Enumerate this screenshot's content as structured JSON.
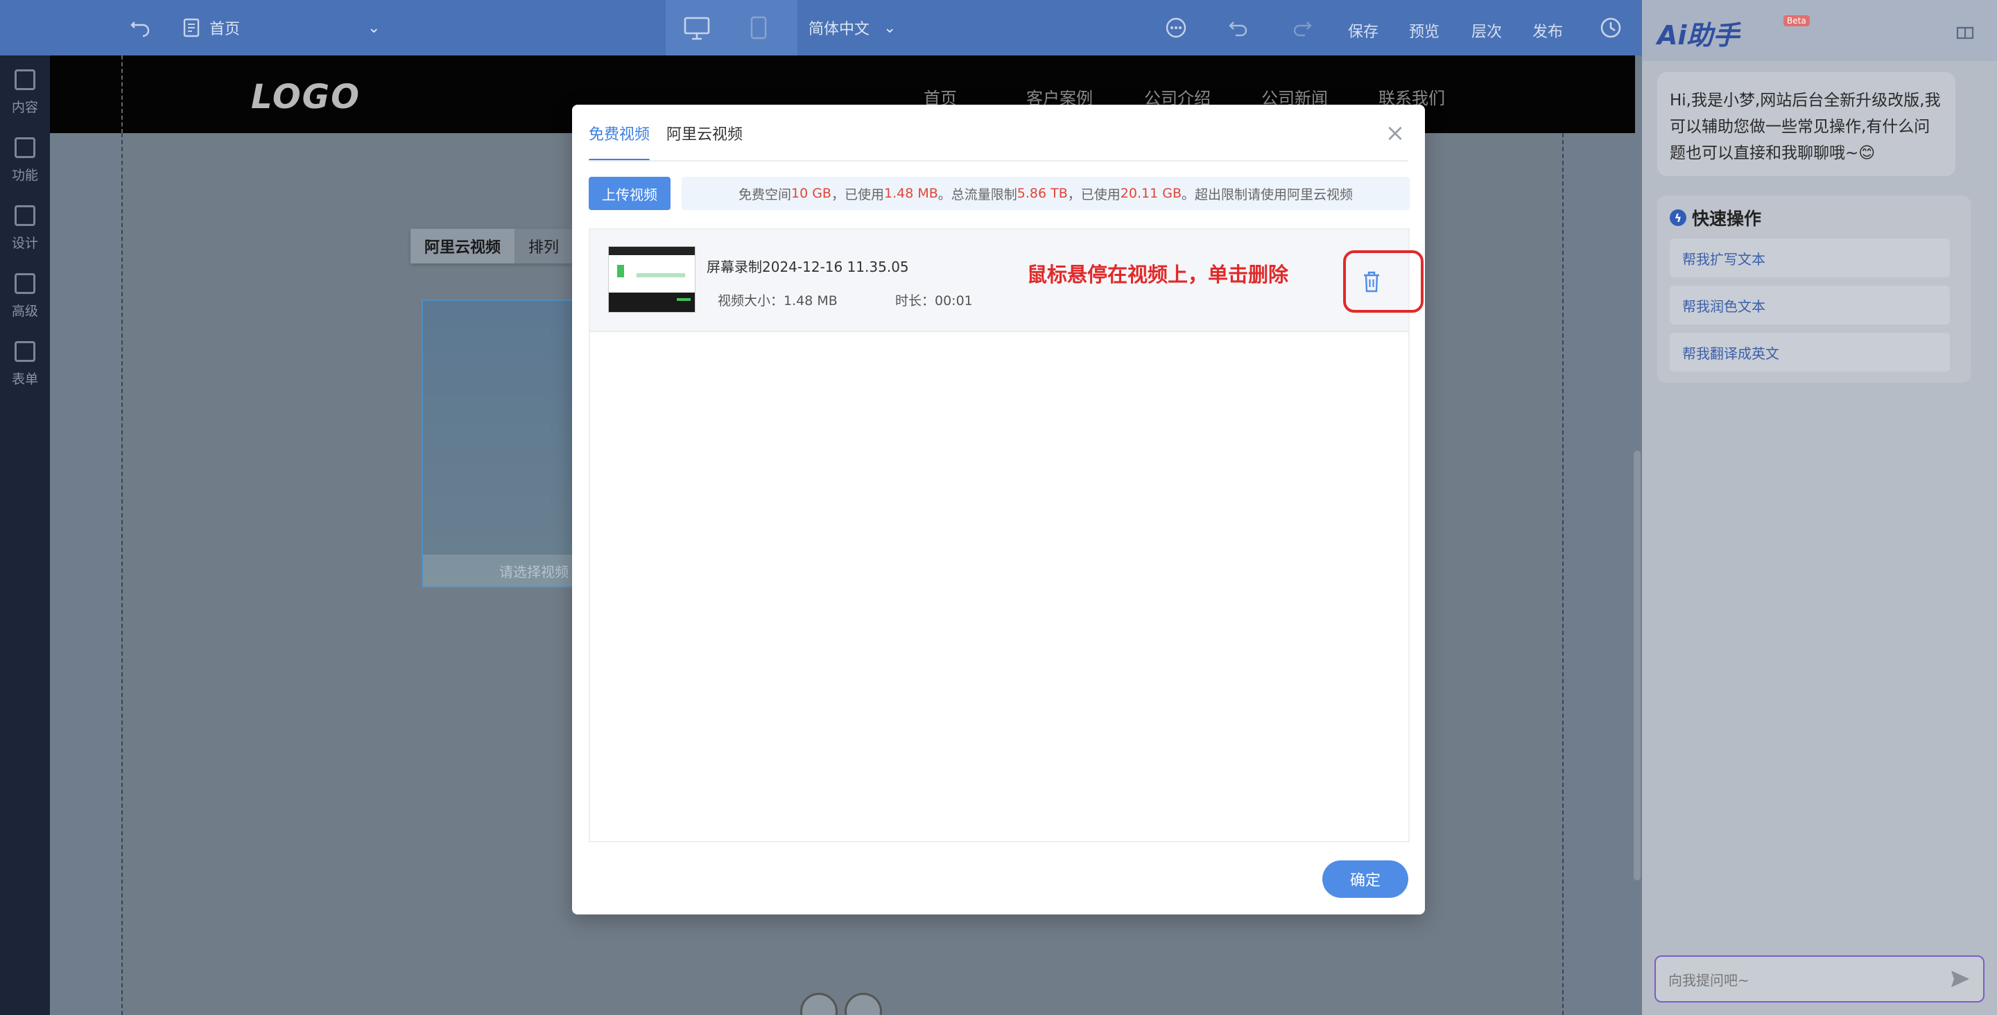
{
  "topbar": {
    "page_select": "首页",
    "language": "简体中文",
    "save": "保存",
    "preview": "预览",
    "layers": "层次",
    "publish": "发布"
  },
  "sidebar": {
    "items": [
      {
        "label": "内容",
        "icon": "document-icon"
      },
      {
        "label": "功能",
        "icon": "grid-icon"
      },
      {
        "label": "设计",
        "icon": "layout-icon"
      },
      {
        "label": "高级",
        "icon": "code-icon"
      },
      {
        "label": "表单",
        "icon": "form-icon"
      }
    ]
  },
  "site": {
    "logo": "LOGO",
    "nav": [
      "首页",
      "客户案例",
      "公司介绍",
      "公司新闻",
      "联系我们"
    ],
    "widget_tabs": [
      "阿里云视频",
      "排列"
    ],
    "video_placeholder": "请选择视频"
  },
  "ai": {
    "title": "Ai助手",
    "beta": "Beta",
    "greeting": "Hi,我是小梦,网站后台全新升级改版,我可以辅助您做一些常见操作,有什么问题也可以直接和我聊聊哦~😊",
    "quick_title": "快速操作",
    "quick_actions": [
      "帮我扩写文本",
      "帮我润色文本",
      "帮我翻译成英文"
    ],
    "input_placeholder": "向我提问吧~"
  },
  "modal": {
    "tabs": [
      "免费视频",
      "阿里云视频"
    ],
    "upload_label": "上传视频",
    "quota": {
      "p1": "免费空间",
      "free_space": "10 GB",
      "p2": "，已使用",
      "used_space": "1.48 MB",
      "p3": "。总流量限制",
      "traffic_limit": "5.86 TB",
      "p4": "，已使用",
      "traffic_used": "20.11 GB",
      "p5": "。超出限制请使用阿里云视频"
    },
    "file": {
      "name": "屏幕录制2024-12-16 11.35.05",
      "size": "视频大小：1.48 MB",
      "duration": "时长：00:01"
    },
    "hint": "鼠标悬停在视频上，单击删除",
    "confirm_label": "确定"
  },
  "colors": {
    "accent": "#4e8ce6",
    "warning_red": "#e02a2a",
    "topbar": "#4a72b6"
  }
}
